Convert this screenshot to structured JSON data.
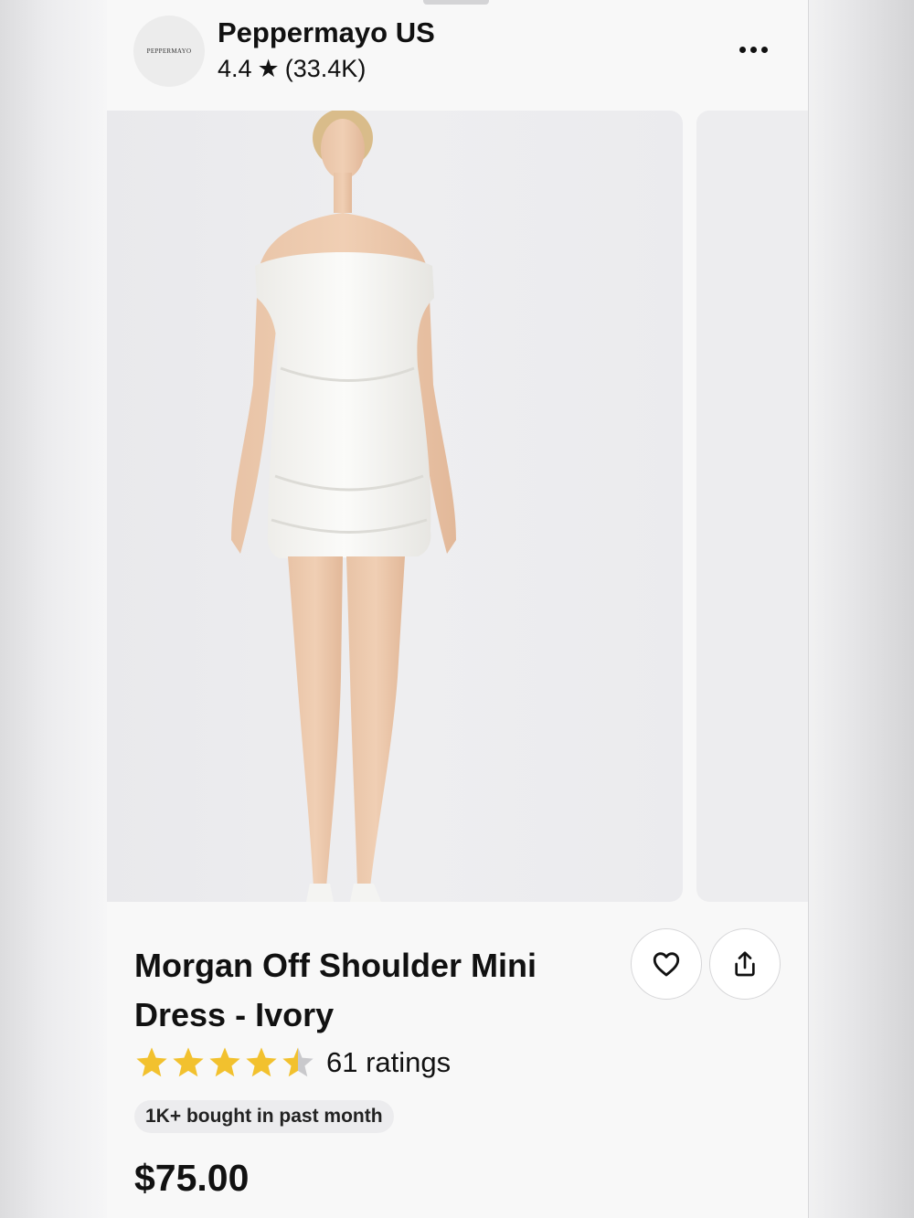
{
  "store": {
    "logo_text": "PEPPERMAYO",
    "name": "Peppermayo US",
    "rating": "4.4",
    "rating_star": "★",
    "rating_count": "(33.4K)"
  },
  "header": {
    "more_icon": "more-horizontal-icon"
  },
  "product": {
    "title": "Morgan Off Shoulder Mini Dress - Ivory",
    "stars_value": 4.5,
    "stars_max": 5,
    "ratings_label": "61 ratings",
    "badge": "1K+ bought in past month",
    "price": "$75.00"
  },
  "actions": {
    "favorite_icon": "heart-icon",
    "share_icon": "share-icon"
  },
  "colors": {
    "star": "#F2C12E",
    "star_empty": "#C9C9CC",
    "text": "#111111"
  }
}
